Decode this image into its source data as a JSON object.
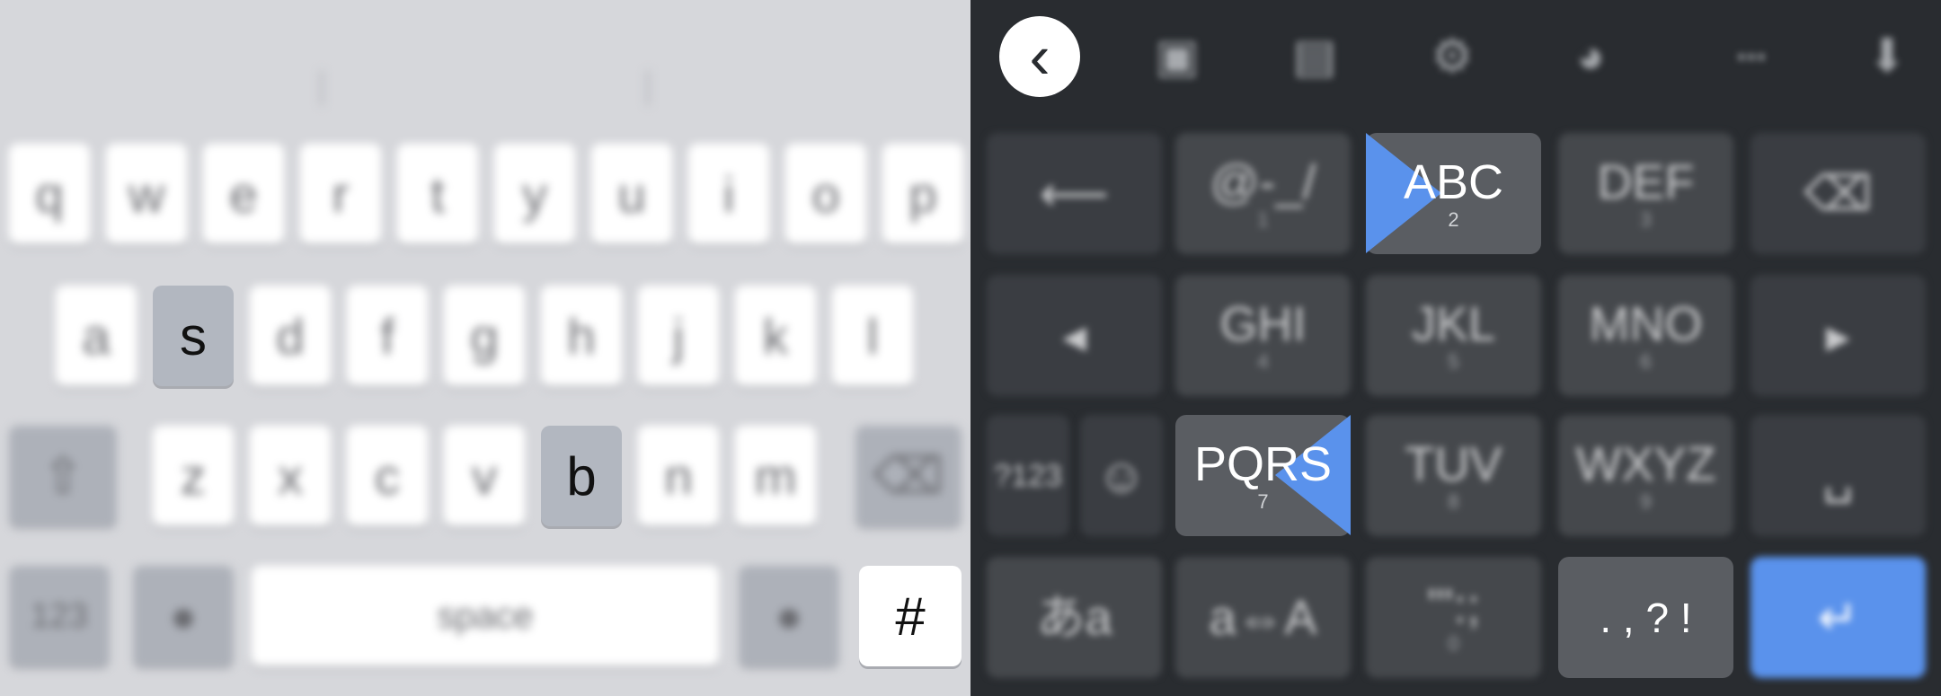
{
  "left_keyboard": {
    "row1": [
      "q",
      "w",
      "e",
      "r",
      "t",
      "y",
      "u",
      "i",
      "o",
      "p"
    ],
    "row2": [
      "a",
      "s",
      "d",
      "f",
      "g",
      "h",
      "j",
      "k",
      "l"
    ],
    "row3": [
      "z",
      "x",
      "c",
      "v",
      "b",
      "n",
      "m"
    ],
    "numbers_key": "123",
    "space_key": "space",
    "hash_key": "#",
    "highlighted_keys": [
      "s",
      "b",
      "#"
    ]
  },
  "right_keyboard": {
    "toolbar_icons": [
      "back-icon",
      "sticker-icon",
      "clipboard-icon",
      "gear-icon",
      "palette-icon",
      "more-icon",
      "mic-icon"
    ],
    "row1": [
      {
        "main": "",
        "sub": "",
        "icon": "undo-arrow-icon"
      },
      {
        "main": "@-_/",
        "sub": "1"
      },
      {
        "main": "ABC",
        "sub": "2"
      },
      {
        "main": "DEF",
        "sub": "3"
      },
      {
        "main": "",
        "sub": "",
        "icon": "backspace-icon"
      }
    ],
    "row2": [
      {
        "main": "◂",
        "sub": "",
        "icon": "cursor-left-icon"
      },
      {
        "main": "GHI",
        "sub": "4"
      },
      {
        "main": "JKL",
        "sub": "5"
      },
      {
        "main": "MNO",
        "sub": "6"
      },
      {
        "main": "▸",
        "sub": "",
        "icon": "cursor-right-icon"
      }
    ],
    "row3": [
      {
        "main": "?123",
        "sub": ""
      },
      {
        "main": "☺",
        "sub": "",
        "icon": "emoji-icon"
      },
      {
        "main": "PQRS",
        "sub": "7"
      },
      {
        "main": "TUV",
        "sub": "8"
      },
      {
        "main": "WXYZ",
        "sub": "9"
      },
      {
        "main": "␣",
        "sub": "",
        "icon": "space-icon"
      }
    ],
    "row4": [
      {
        "main": "あa",
        "sub": "",
        "icon": "language-switch-icon"
      },
      {
        "main": "a⇔A",
        "sub": ""
      },
      {
        "main": "'\":;",
        "sub": "0"
      },
      {
        "main": ". , ? !",
        "sub": ""
      },
      {
        "main": "↵",
        "sub": "",
        "icon": "enter-icon"
      }
    ],
    "highlighted_keys": [
      "ABC",
      "PQRS",
      ". , ? !"
    ],
    "accent_color": "#5a92ec"
  }
}
